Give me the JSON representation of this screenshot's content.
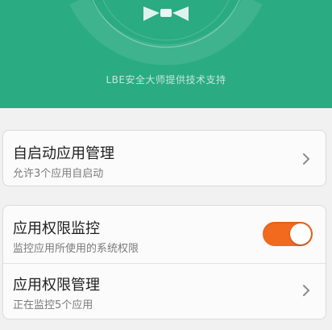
{
  "banner": {
    "credit": "LBE安全大师提供技术支持",
    "icon": "shield-icon",
    "color": "#2aab82"
  },
  "autostart": {
    "title": "自启动应用管理",
    "subtitle": "允许3个应用自启动",
    "icon": "chevron-right-icon"
  },
  "permission_monitor": {
    "title": "应用权限监控",
    "subtitle": "监控应用所使用的系统权限",
    "toggle_on": true,
    "toggle_color": "#f16a1d"
  },
  "permission_manage": {
    "title": "应用权限管理",
    "subtitle": "正在监控5个应用",
    "icon": "chevron-right-icon"
  }
}
